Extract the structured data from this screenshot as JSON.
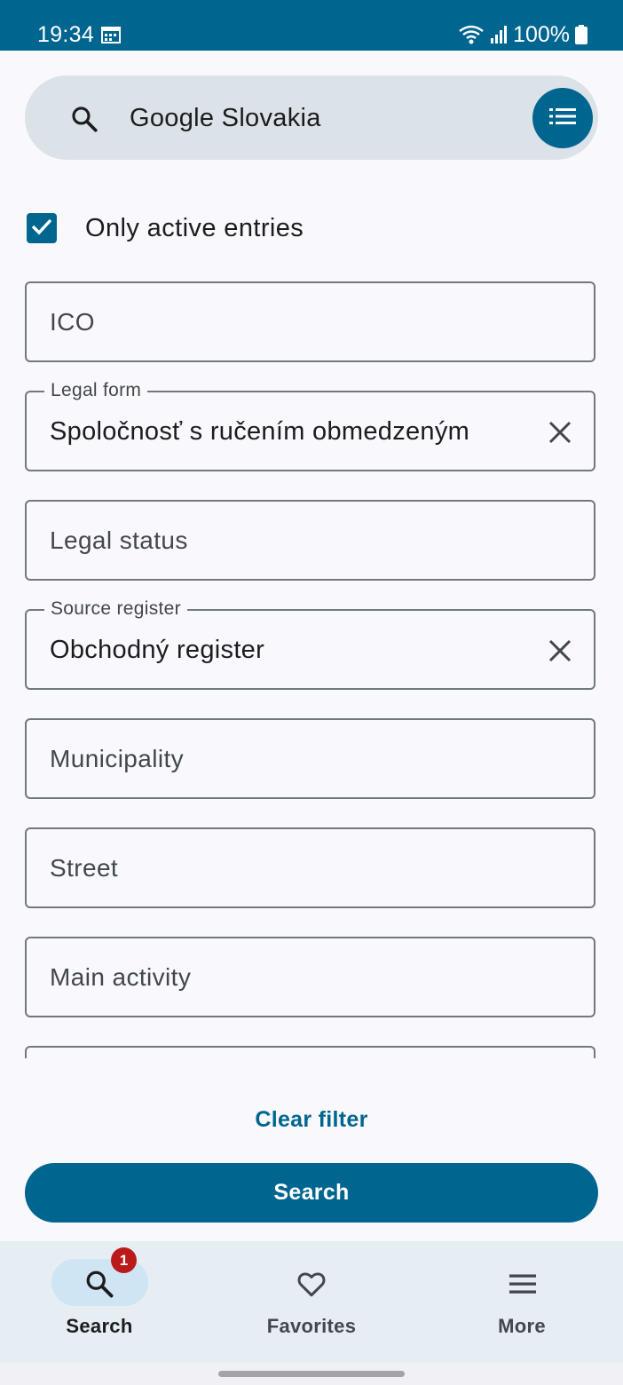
{
  "status_bar": {
    "time": "19:34",
    "battery": "100%",
    "icons": [
      "calendar-icon",
      "wifi-icon",
      "signal-icon",
      "battery-icon"
    ]
  },
  "search": {
    "query": "Google Slovakia",
    "icons": [
      "search-icon",
      "list-icon"
    ]
  },
  "filter": {
    "only_active_label": "Only active entries",
    "only_active_checked": true
  },
  "fields": {
    "ico": {
      "placeholder": "ICO"
    },
    "legal_form": {
      "label": "Legal form",
      "value": "Spoločnosť s ručením obmedzeným"
    },
    "legal_status": {
      "placeholder": "Legal status"
    },
    "source_register": {
      "label": "Source register",
      "value": "Obchodný register"
    },
    "municipality": {
      "placeholder": "Municipality"
    },
    "street": {
      "placeholder": "Street"
    },
    "main_activity": {
      "placeholder": "Main activity"
    }
  },
  "actions": {
    "clear_filter": "Clear filter",
    "search": "Search"
  },
  "nav": {
    "search": {
      "label": "Search",
      "badge": "1"
    },
    "favorites": {
      "label": "Favorites"
    },
    "more": {
      "label": "More"
    }
  },
  "colors": {
    "primary": "#00658f",
    "background": "#f9f9fd",
    "search_bar": "#dbe2e8",
    "nav_background": "#e6eef3",
    "nav_active_pill": "#cfe5f4",
    "badge": "#ba1a1a"
  }
}
